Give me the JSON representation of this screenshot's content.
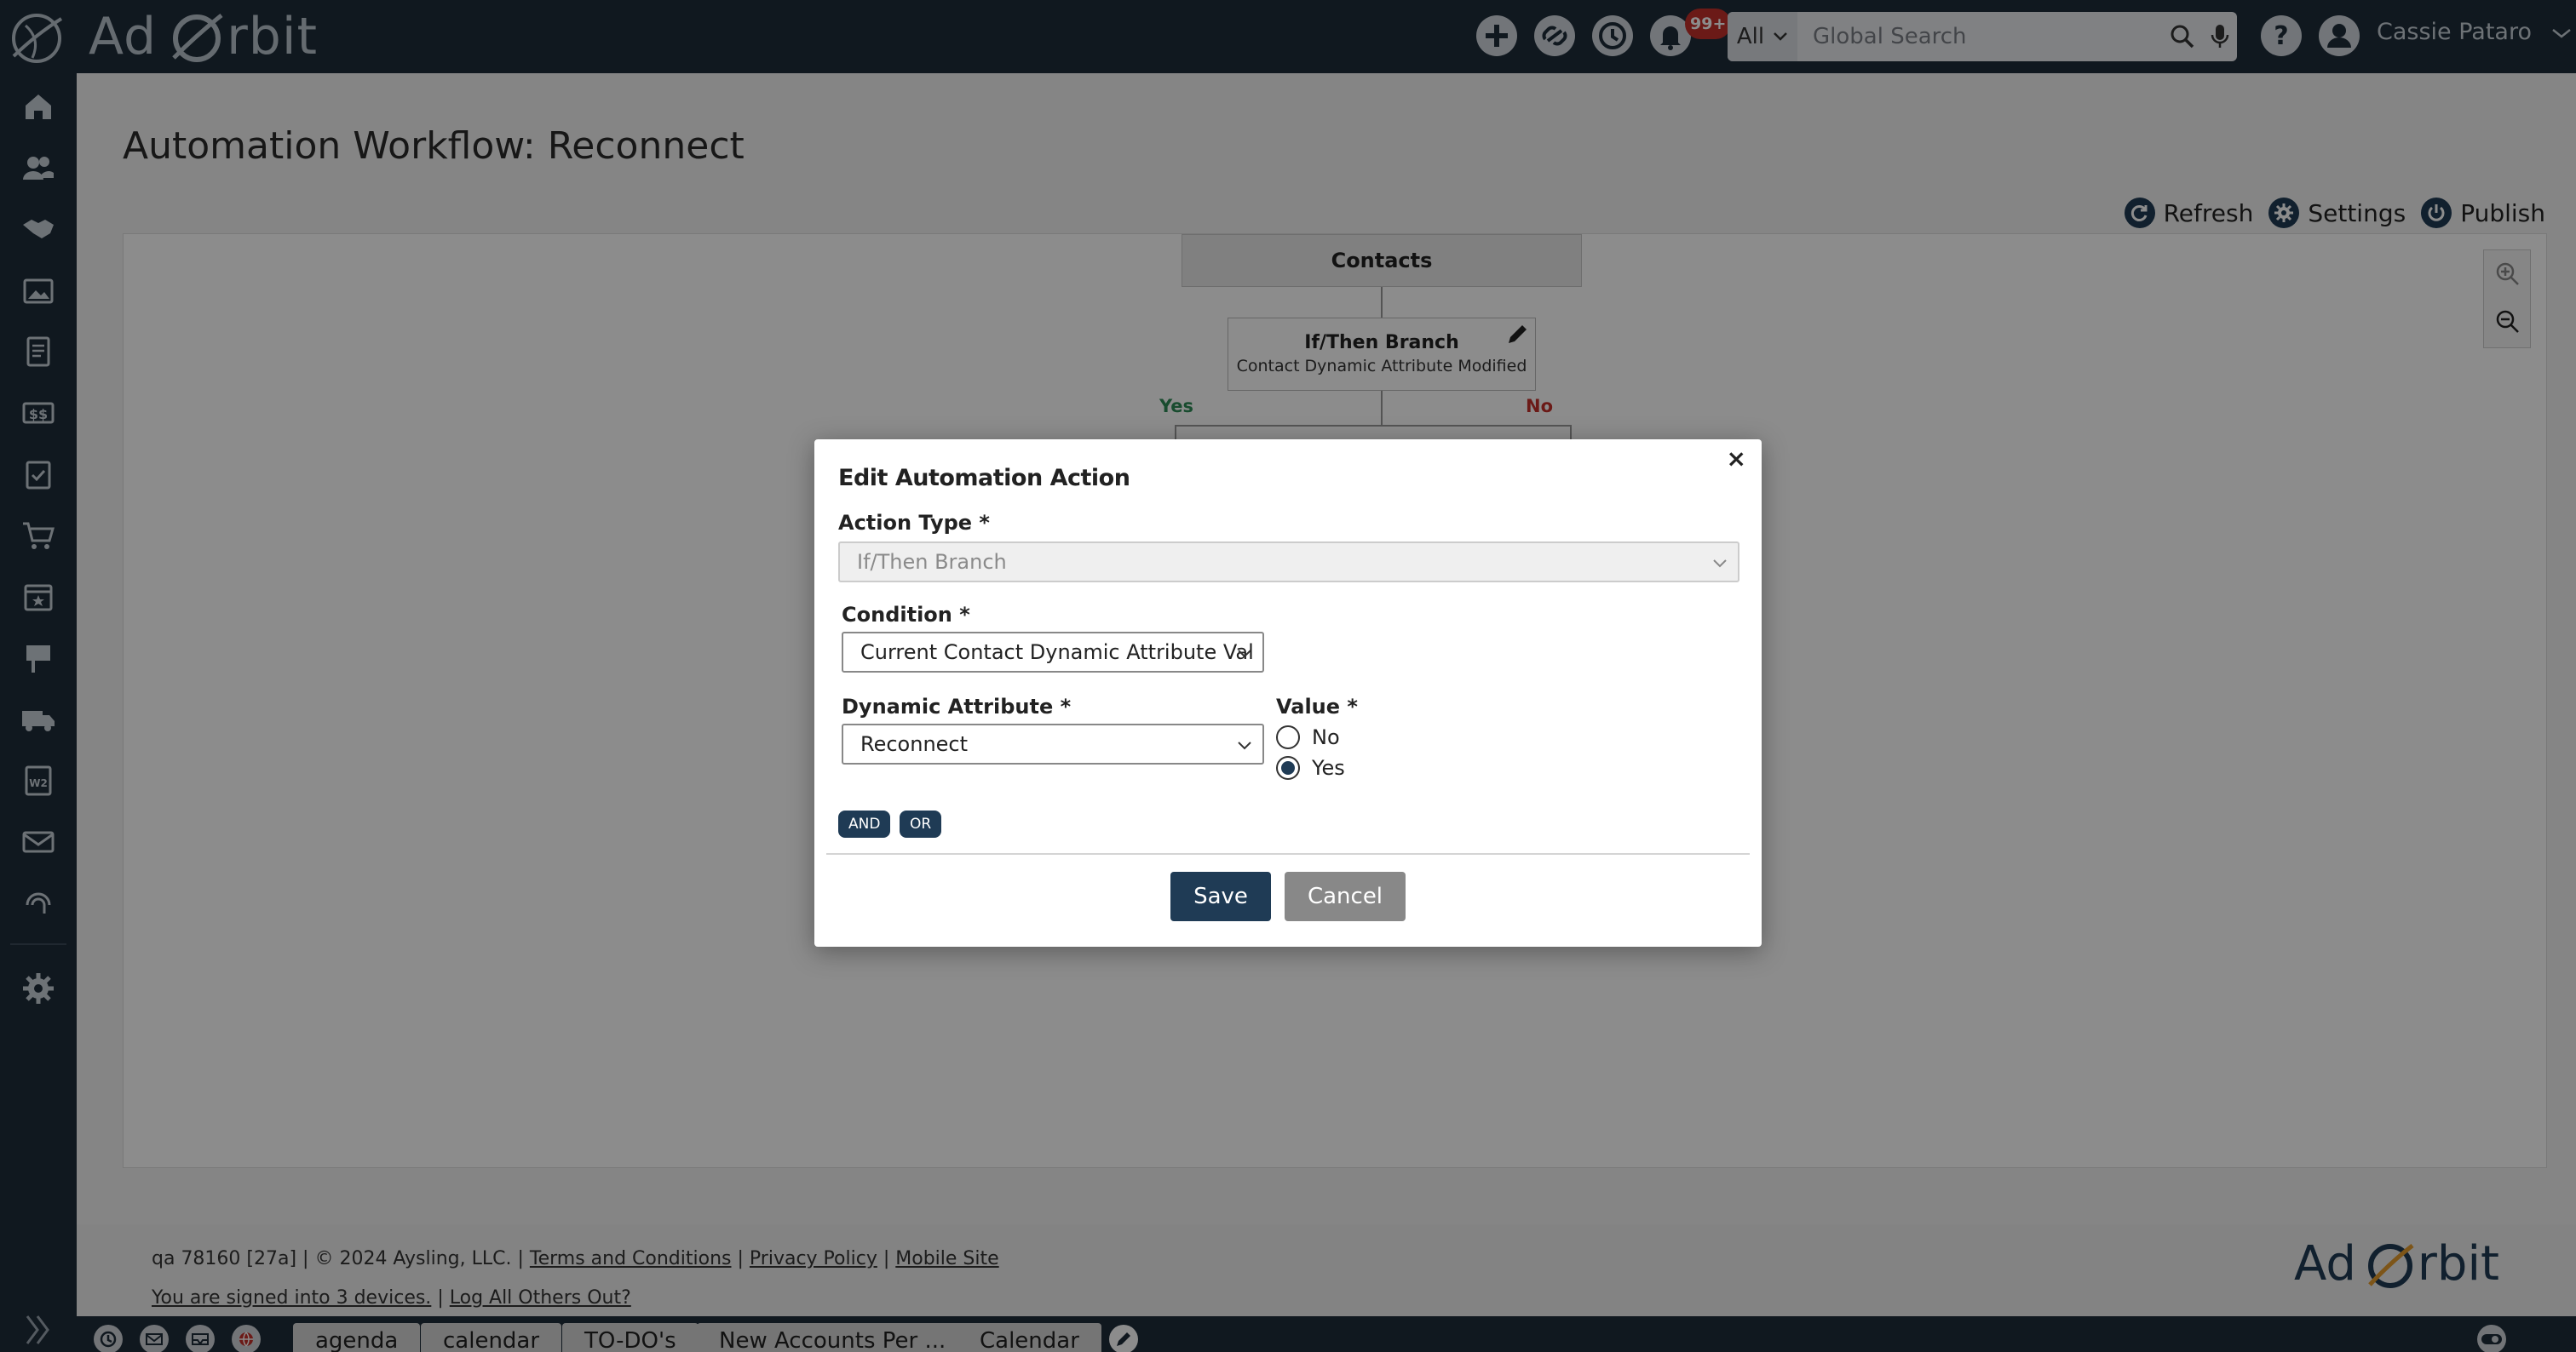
{
  "brand": {
    "name_left": "Ad",
    "name_right": "rbit"
  },
  "header": {
    "search_scope": "All",
    "search_placeholder": "Global Search",
    "notification_badge": "99+",
    "user_name": "Cassie Pataro"
  },
  "sidebar": {
    "items": [
      {
        "icon": "home-icon"
      },
      {
        "icon": "contacts-icon"
      },
      {
        "icon": "handshake-icon"
      },
      {
        "icon": "media-icon"
      },
      {
        "icon": "documents-icon"
      },
      {
        "icon": "billing-icon"
      },
      {
        "icon": "tasks-icon"
      },
      {
        "icon": "cart-icon"
      },
      {
        "icon": "calendar-icon"
      },
      {
        "icon": "campaign-icon"
      },
      {
        "icon": "delivery-icon"
      },
      {
        "icon": "w2-icon"
      },
      {
        "icon": "mail-icon"
      },
      {
        "icon": "marketing-icon"
      },
      {
        "icon": "settings-icon"
      }
    ]
  },
  "page": {
    "title": "Automation Workflow: Reconnect",
    "toolbar": {
      "refresh": "Refresh",
      "settings": "Settings",
      "publish": "Publish"
    }
  },
  "workflow": {
    "root_node": "Contacts",
    "branch_title": "If/Then Branch",
    "branch_subtitle": "Contact Dynamic Attribute Modified",
    "yes_label": "Yes",
    "no_label": "No"
  },
  "modal": {
    "title": "Edit Automation Action",
    "close": "×",
    "action_type_label": "Action Type *",
    "action_type_value": "If/Then Branch",
    "condition_label": "Condition *",
    "condition_value": "Current Contact Dynamic Attribute Val",
    "dynamic_attribute_label": "Dynamic Attribute *",
    "dynamic_attribute_value": "Reconnect",
    "value_label": "Value *",
    "value_options": [
      "No",
      "Yes"
    ],
    "value_selected": "Yes",
    "and_label": "AND",
    "or_label": "OR",
    "save_label": "Save",
    "cancel_label": "Cancel"
  },
  "footer": {
    "build": "qa 78160 [27a] | © 2024 Aysling, LLC. |",
    "terms": "Terms and Conditions",
    "sep1": "|",
    "privacy": "Privacy Policy",
    "sep2": "|",
    "mobile": "Mobile Site",
    "signed_in": "You are signed into 3 devices.",
    "sep3": "|",
    "log_out": "Log All Others Out?"
  },
  "taskbar": {
    "tabs": [
      "agenda",
      "calendar",
      "TO-DO's",
      "New Accounts Per ...",
      "Calendar"
    ]
  },
  "colors": {
    "nav_bg": "#1e2c3a",
    "accent": "#1f3b55",
    "badge": "#c4302b",
    "yes": "#2e8b57",
    "no": "#c4302b"
  }
}
